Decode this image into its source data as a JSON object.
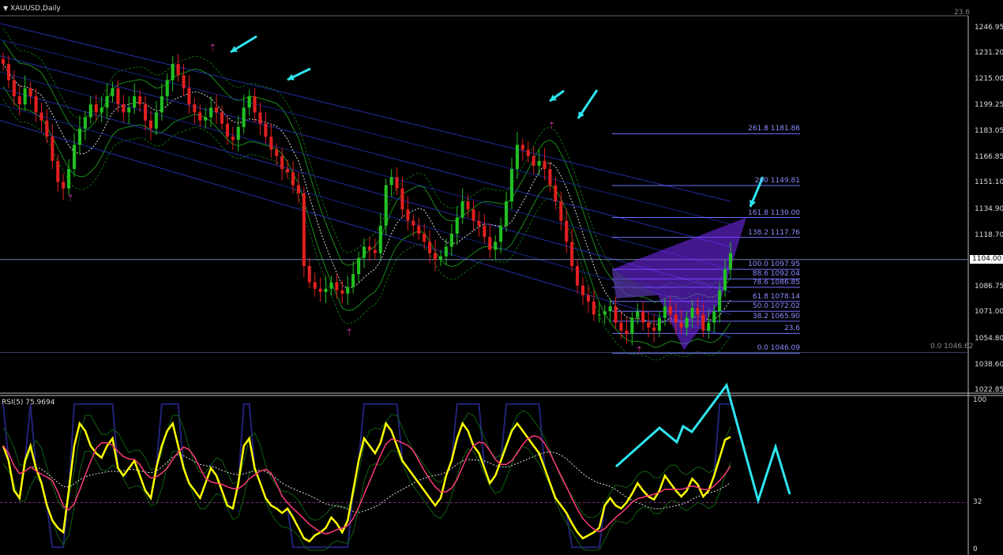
{
  "window": {
    "symbol_title": "XAUUSD,Daily",
    "top_right_label": "23.6",
    "menu_icon": "triangle-down-icon"
  },
  "price_axis": {
    "labels": [
      "1246.95",
      "1231.20",
      "1215.00",
      "1199.25",
      "1183.05",
      "1166.85",
      "1151.10",
      "1134.90",
      "1118.70",
      "1104.00",
      "1086.75",
      "1071.00",
      "1054.80",
      "1038.60",
      "1022.85"
    ],
    "current": "1104.00"
  },
  "fibonacci": {
    "levels": [
      {
        "label": "261.8  1181.86",
        "price": 1181.86
      },
      {
        "label": "200  1149.81",
        "price": 1149.81
      },
      {
        "label": "161.8  1130.00",
        "price": 1130.0
      },
      {
        "label": "138.2  1117.76",
        "price": 1117.76
      },
      {
        "label": "100.0  1097.95",
        "price": 1097.95
      },
      {
        "label": "88.6  1092.04",
        "price": 1092.04
      },
      {
        "label": "78.6  1086.85",
        "price": 1086.85
      },
      {
        "label": "61.8  1078.14",
        "price": 1078.14
      },
      {
        "label": "50.0  1072.02",
        "price": 1072.02
      },
      {
        "label": "38.2  1065.90",
        "price": 1065.9
      },
      {
        "label": "23.6",
        "price": 1058.3
      },
      {
        "label": "0.0  1046.09",
        "price": 1046.09
      }
    ],
    "side_label": "0.0  1046.62",
    "color": "#6f72ff"
  },
  "rsi": {
    "title": "RSI(5) 75.9694",
    "axis_labels": [
      "100",
      "32",
      "0"
    ],
    "level": 32,
    "value": 75.9694,
    "line_color": "#ffff00"
  },
  "colors": {
    "background": "#000000",
    "bull_candle": "#22c022",
    "bear_candle": "#e02020",
    "annotation_arrow": "#2ee6f0",
    "pattern_fill": "#7a2cff",
    "grid_line": "#5c6aa0"
  },
  "chart_data": {
    "type": "line",
    "title": "XAUUSD,Daily",
    "xlabel": "",
    "ylabel": "",
    "ylim": [
      1016,
      1255
    ],
    "x": [
      1,
      2,
      3,
      4,
      5,
      6,
      7,
      8,
      9,
      10,
      11,
      12,
      13,
      14,
      15,
      16,
      17,
      18,
      19,
      20,
      21,
      22,
      23,
      24,
      25,
      26,
      27,
      28,
      29,
      30,
      31,
      32,
      33,
      34,
      35,
      36,
      37,
      38,
      39,
      40,
      41,
      42,
      43,
      44,
      45,
      46,
      47,
      48,
      49,
      50,
      51,
      52,
      53,
      54,
      55,
      56,
      57,
      58,
      59,
      60,
      61,
      62,
      63,
      64,
      65,
      66,
      67,
      68,
      69,
      70,
      71,
      72,
      73,
      74,
      75,
      76,
      77,
      78,
      79,
      80,
      81,
      82,
      83,
      84,
      85,
      86,
      87,
      88,
      89,
      90,
      91,
      92,
      93,
      94,
      95,
      96,
      97,
      98,
      99,
      100,
      101,
      102,
      103,
      104,
      105,
      106,
      107,
      108,
      109,
      110,
      111,
      112,
      113,
      114,
      115,
      116,
      117,
      118,
      119,
      120,
      121,
      122,
      123,
      124,
      125,
      126,
      127,
      128,
      129,
      130,
      131,
      132,
      133,
      134,
      135,
      136,
      137,
      138,
      139,
      140,
      141,
      142,
      143,
      144,
      145,
      146,
      147,
      148,
      149,
      150,
      151,
      152,
      153
    ],
    "series": [
      {
        "name": "XAUUSD",
        "values": [
          1225,
          1215,
          1205,
          1200,
          1210,
          1205,
          1195,
          1190,
          1180,
          1165,
          1152,
          1148,
          1160,
          1175,
          1185,
          1192,
          1200,
          1195,
          1198,
          1205,
          1210,
          1200,
          1195,
          1198,
          1205,
          1200,
          1190,
          1185,
          1195,
          1205,
          1215,
          1225,
          1218,
          1210,
          1200,
          1195,
          1190,
          1192,
          1198,
          1195,
          1188,
          1180,
          1178,
          1186,
          1198,
          1205,
          1195,
          1188,
          1180,
          1172,
          1168,
          1160,
          1158,
          1150,
          1145,
          1100,
          1090,
          1086,
          1084,
          1086,
          1090,
          1085,
          1083,
          1087,
          1095,
          1105,
          1112,
          1110,
          1108,
          1125,
          1150,
          1155,
          1148,
          1135,
          1128,
          1125,
          1120,
          1115,
          1108,
          1104,
          1106,
          1112,
          1120,
          1130,
          1140,
          1135,
          1128,
          1125,
          1118,
          1110,
          1115,
          1125,
          1140,
          1160,
          1175,
          1172,
          1168,
          1162,
          1165,
          1160,
          1150,
          1140,
          1128,
          1115,
          1100,
          1088,
          1082,
          1078,
          1070,
          1070,
          1072,
          1075,
          1065,
          1060,
          1058,
          1068,
          1072,
          1065,
          1062,
          1060,
          1068,
          1075,
          1070,
          1065,
          1062,
          1068,
          1074,
          1070,
          1060,
          1065,
          1072,
          1085,
          1098,
          1108
        ]
      },
      {
        "name": "RSI(5)",
        "values": [
          70,
          60,
          40,
          35,
          60,
          70,
          55,
          45,
          30,
          20,
          15,
          12,
          40,
          70,
          85,
          80,
          70,
          65,
          62,
          70,
          75,
          55,
          50,
          55,
          60,
          50,
          40,
          35,
          55,
          70,
          80,
          85,
          70,
          55,
          45,
          40,
          35,
          45,
          55,
          50,
          40,
          30,
          28,
          45,
          70,
          75,
          55,
          45,
          35,
          30,
          28,
          25,
          28,
          22,
          15,
          8,
          6,
          10,
          12,
          15,
          22,
          18,
          12,
          20,
          40,
          60,
          75,
          70,
          65,
          72,
          85,
          80,
          70,
          60,
          55,
          50,
          45,
          40,
          35,
          30,
          35,
          50,
          60,
          75,
          85,
          80,
          70,
          65,
          55,
          45,
          50,
          60,
          70,
          80,
          85,
          80,
          75,
          70,
          65,
          55,
          45,
          35,
          30,
          25,
          18,
          12,
          8,
          10,
          12,
          15,
          30,
          35,
          30,
          28,
          32,
          38,
          45,
          40,
          36,
          34,
          40,
          50,
          45,
          40,
          36,
          40,
          48,
          44,
          36,
          40,
          50,
          62,
          74,
          76
        ]
      }
    ],
    "rsi_ylim": [
      0,
      100
    ]
  }
}
